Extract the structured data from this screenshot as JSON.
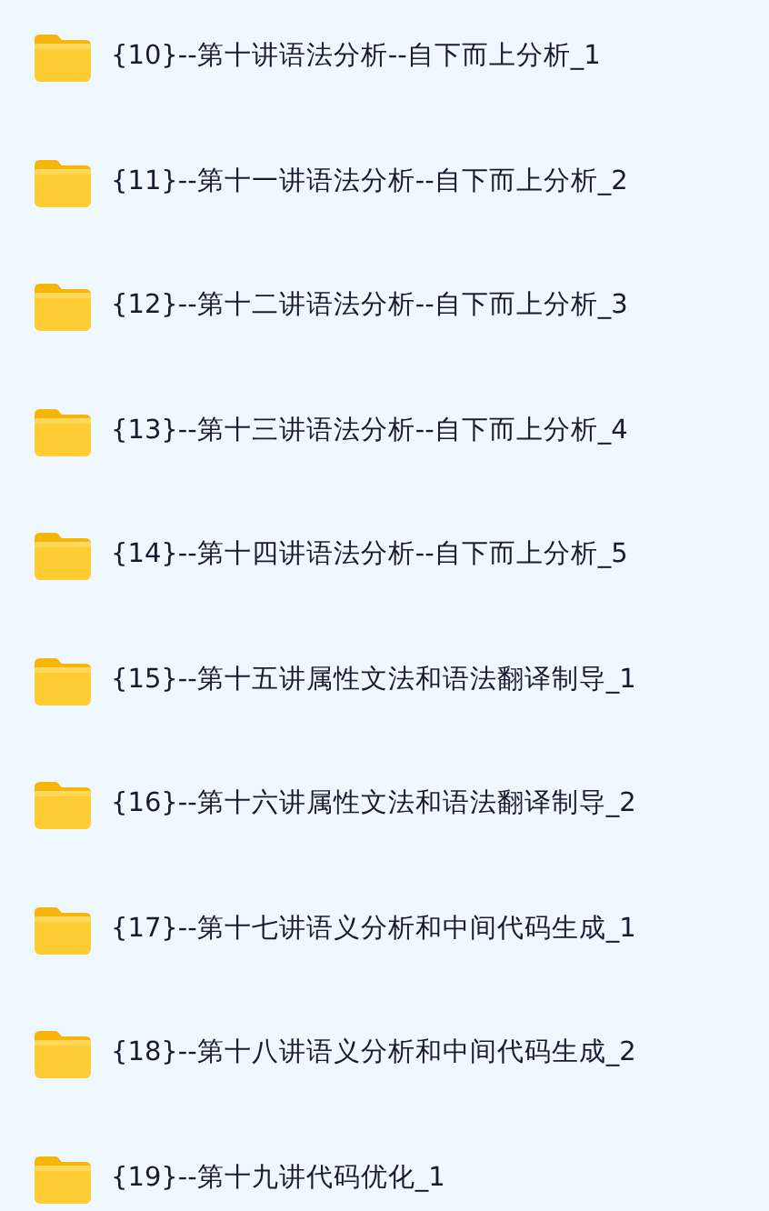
{
  "folders": [
    {
      "name": "{10}--第十讲语法分析--自下而上分析_1"
    },
    {
      "name": "{11}--第十一讲语法分析--自下而上分析_2"
    },
    {
      "name": "{12}--第十二讲语法分析--自下而上分析_3"
    },
    {
      "name": "{13}--第十三讲语法分析--自下而上分析_4"
    },
    {
      "name": "{14}--第十四讲语法分析--自下而上分析_5"
    },
    {
      "name": "{15}--第十五讲属性文法和语法翻译制导_1"
    },
    {
      "name": "{16}--第十六讲属性文法和语法翻译制导_2"
    },
    {
      "name": "{17}--第十七讲语义分析和中间代码生成_1"
    },
    {
      "name": "{18}--第十八讲语义分析和中间代码生成_2"
    },
    {
      "name": "{19}--第十九讲代码优化_1"
    }
  ]
}
